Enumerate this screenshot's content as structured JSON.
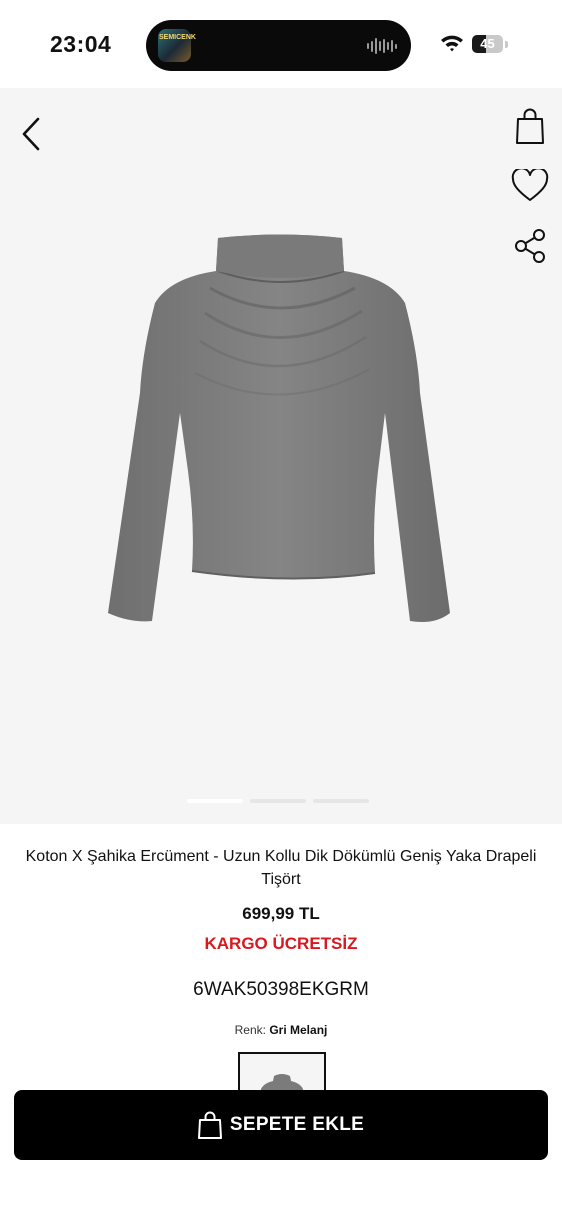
{
  "status_bar": {
    "time": "23:04",
    "now_playing_art_text": "SEMICENK",
    "battery_level": 45,
    "battery_text": "45",
    "wifi_icon": "wifi-icon",
    "waveform_icon": "audio-waveform-icon"
  },
  "gallery": {
    "back_icon": "chevron-left-icon",
    "actions": [
      "shopping-bag-icon",
      "heart-icon",
      "share-icon"
    ],
    "image_count": 3,
    "active_image_index": 0
  },
  "product": {
    "title": "Koton X Şahika Ercüment - Uzun Kollu Dik Dökümlü Geniş Yaka Drapeli Tişört",
    "price": "699,99 TL",
    "shipping": "KARGO ÜCRETSİZ",
    "sku": "6WAK50398EKGRM",
    "color_label": "Renk:",
    "color_value": "Gri Melanj"
  },
  "cart_button": {
    "label": "SEPETE EKLE",
    "icon": "shopping-bag-icon"
  },
  "colors": {
    "accent_red": "#d71920",
    "button_black": "#000000",
    "gallery_bg": "#f5f5f5",
    "garment_gray": "#7b7b7b"
  }
}
